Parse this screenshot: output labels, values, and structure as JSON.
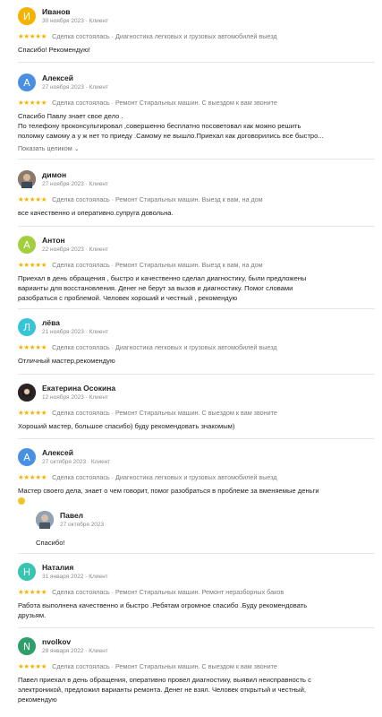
{
  "reviews": [
    {
      "initial": "И",
      "color": "#f5b300",
      "name": "Иванов",
      "date": "30 ноября 2023 · Клиент",
      "meta": "Сделка состоялась · Диагностика легковых и грузовых автомобилей выезд",
      "text": [
        "Спасибо! Рекомендую!"
      ]
    },
    {
      "initial": "А",
      "color": "#4a90e2",
      "name": "Алексей",
      "date": "27 ноября 2023 · Клиент",
      "meta": "Сделка состоялась · Ремонт Стиральных машин. С выездом к вам звоните",
      "text": [
        "Спасибо Павлу знает свое дело .",
        "По телефону проконсультировал ,совершенно бесплатно посоветовал как можно решить",
        "поломку самому а у ж нет то приеду .Самому не вышло.Приехал как договорились все быстро..."
      ],
      "more": "Показать целиком"
    },
    {
      "initial": "",
      "color": "#6b5a4e",
      "name": "димон",
      "date": "27 ноября 2023 · Клиент",
      "meta": "Сделка состоялась · Ремонт Стиральных машин. Выезд к вам, на дом",
      "text": [
        "все качественно и оперативно.супруга довольна."
      ]
    },
    {
      "initial": "А",
      "color": "#a3cf3e",
      "name": "Антон",
      "date": "22 ноября 2023 · Клиент",
      "meta": "Сделка состоялась · Ремонт Стиральных машин. Выезд к вам, на дом",
      "text": [
        "Приехал в день обращения , быстро и качественно сделал диагностику, были предложены",
        "варианты для восстановления. Денег не берут за вызов и диагностику. Помог словами",
        "разобраться с проблемой. Человек хороший и честный , рекомендую"
      ]
    },
    {
      "initial": "Л",
      "color": "#36c5d8",
      "name": "лёва",
      "date": "21 ноября 2023 · Клиент",
      "meta": "Сделка состоялась · Диагностика легковых и грузовых автомобилей выезд",
      "text": [
        "Отличный мастер,рекомендую"
      ]
    },
    {
      "initial": "",
      "color": "#3a3030",
      "name": "Екатерина Осокина",
      "date": "12 ноября 2023 · Клиент",
      "meta": "Сделка состоялась · Ремонт Стиральных машин. С выездом к вам звоните",
      "text": [
        "Хороший мастер, большое спасибо) буду рекомендовать знакомым)"
      ]
    },
    {
      "initial": "А",
      "color": "#4a90e2",
      "name": "Алексей",
      "date": "27 октября 2023 · Клиент",
      "meta": "Сделка состоялась · Диагностика легковых и грузовых автомобилей выезд",
      "text": [
        "Мастер своего дела, знает о чем говорит, помог разобраться в проблеме за вменяемые деньги"
      ],
      "reply": {
        "name": "Павел",
        "date": "27 октября 2023",
        "text": "Спасибо!"
      }
    },
    {
      "initial": "Н",
      "color": "#36c5b0",
      "name": "Наталия",
      "date": "31 января 2022 · Клиент",
      "meta": "Сделка состоялась · Ремонт Стиральных машин. Ремонт неразборных баков",
      "text": [
        "Работа выполнена качественно и быстро .Ребятам огромное спасибо .Буду рекомендовать",
        "друзьям."
      ]
    },
    {
      "initial": "N",
      "color": "#2e9e6a",
      "name": "nvolkov",
      "date": "29 января 2022 · Клиент",
      "meta": "Сделка состоялась · Ремонт Стиральных машин. С выездом к вам звоните",
      "text": [
        "Павел приехал в день обращения, оперативно провел диагностику, выявил неисправность с",
        "электроникой, предложил варианты ремонта. Денег не взял. Человек открытый и честный,",
        "рекомендую"
      ]
    }
  ],
  "stars": "★★★★★",
  "more_chevron": "⌄"
}
